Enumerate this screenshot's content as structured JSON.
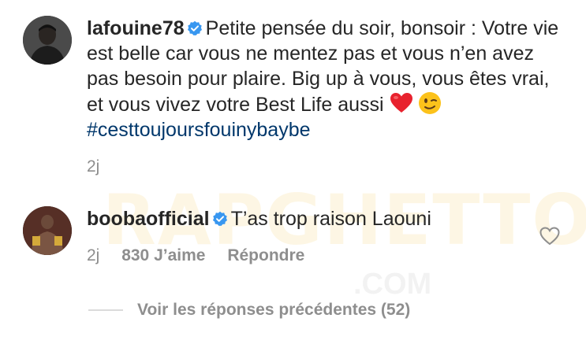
{
  "comment1": {
    "username": "lafouine78",
    "text": "Petite pensée du soir, bonsoir : Votre vie est belle car vous ne mentez pas et vous n’en avez pas besoin pour plaire. Big up à vous, vous êtes vrai, et vous vivez votre Best Life aussi",
    "emojis": [
      "red-heart",
      "winking-face"
    ],
    "hashtag": "#cesttoujoursfouinybaybe",
    "time": "2j"
  },
  "comment2": {
    "username": "boobaofficial",
    "text": "T’as trop raison Laouni",
    "time": "2j",
    "likes": "830 J’aime",
    "reply": "Répondre"
  },
  "view_replies": "Voir les réponses précédentes (52)",
  "watermark": "RAPGHETTO",
  "watermark_sub": ".COM",
  "colors": {
    "text": "#262626",
    "secondary": "#8e8e8e",
    "hashtag": "#00376b",
    "verified": "#3897f0"
  }
}
